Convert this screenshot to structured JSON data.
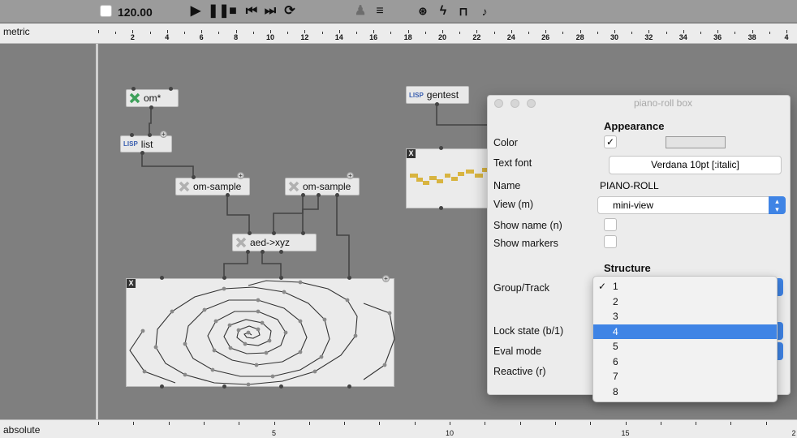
{
  "toolbar": {
    "tempo": "120.00",
    "icons": [
      "play-icon",
      "pause-icon",
      "stop-icon",
      "skip-back-icon",
      "skip-forward-icon",
      "loop-icon",
      "users-icon",
      "list-icon",
      "link-icon",
      "bolt-icon",
      "trash-icon",
      "piano-icon"
    ]
  },
  "ruler_top": {
    "label": "metric",
    "ticks": [
      "2",
      "4",
      "6",
      "8",
      "10",
      "12",
      "14",
      "16",
      "18",
      "20",
      "22",
      "24",
      "26",
      "28",
      "30",
      "32",
      "34",
      "36",
      "38",
      "4"
    ]
  },
  "ruler_bottom": {
    "label": "absolute",
    "ticks": [
      "5",
      "10",
      "15",
      "2"
    ]
  },
  "patch": {
    "om_times": "om*",
    "list": "list",
    "sample1": "om-sample",
    "sample2": "om-sample",
    "aed": "aed->xyz",
    "gentest": "gentest",
    "lisp_badge": "LISP",
    "x_badge": "X"
  },
  "panel": {
    "title": "piano-roll box",
    "appearance_header": "Appearance",
    "structure_header": "Structure",
    "labels": {
      "color": "Color",
      "text_font": "Text font",
      "name": "Name",
      "view": "View (m)",
      "show_name": "Show name (n)",
      "show_markers": "Show markers",
      "group_track": "Group/Track",
      "lock_state": "Lock state (b/1)",
      "eval_mode": "Eval mode",
      "reactive": "Reactive (r)"
    },
    "color_checked": "✓",
    "text_font_value": "Verdana 10pt [:italic]",
    "name_value": "PIANO-ROLL",
    "view_value": "mini-view"
  },
  "dropdown": {
    "options": [
      "1",
      "2",
      "3",
      "4",
      "5",
      "6",
      "7",
      "8"
    ],
    "checked": "1",
    "highlighted": "4",
    "check_mark": "✓"
  },
  "colors": {
    "accent": "#3f84e5",
    "canvas": "#7f7f7f",
    "piano_roll_note": "#d8b440"
  }
}
